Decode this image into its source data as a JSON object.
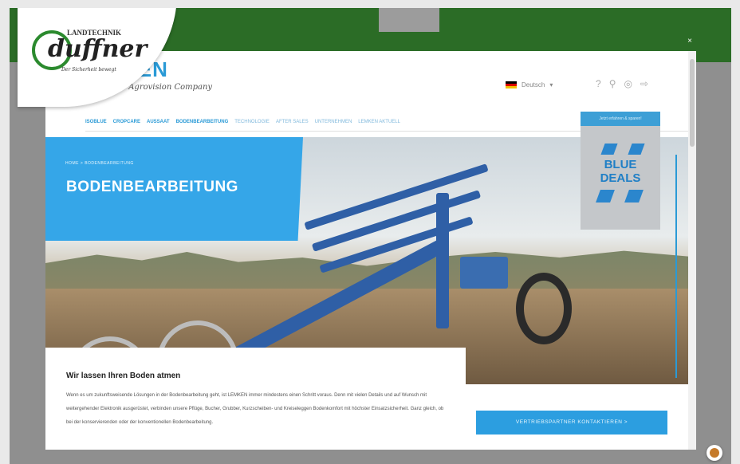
{
  "modal": {
    "close_label": "×"
  },
  "lemken": {
    "logo_text": "EMKEN",
    "tagline": "The Agrovision Company"
  },
  "language": {
    "label": "Deutsch"
  },
  "nav": {
    "items": [
      "ISOBLUE",
      "CROPCARE",
      "AUSSAAT",
      "BODENBEARBEITUNG",
      "TECHNOLOGIE",
      "AFTER SALES",
      "UNTERNEHMEN",
      "LEMKEN AKTUELL"
    ]
  },
  "hero": {
    "breadcrumb": "HOME > BODENBEARBEITUNG",
    "title": "BODENBEARBEITUNG"
  },
  "promo": {
    "top_text": "Jetzt erfahren & sparen!",
    "title": "BLUE DEALS"
  },
  "content": {
    "heading": "Wir lassen Ihren Boden atmen",
    "body": "Wenn es um zukunftsweisende Lösungen in der Bodenbearbeitung geht, ist LEMKEN immer mindestens einen Schritt voraus. Denn mit vielen Details und auf Wunsch mit weitergehender Elektronik ausgerüstet, verbinden unsere Pflüge, Bucher, Grubber, Kurzscheiben- und Kreiseleggen Bodenkomfort mit höchster Einsatzsicherheit. Ganz gleich, ob bei der konservierenden oder der konventionellen Bodenbearbeitung."
  },
  "cta": {
    "label": "VERTRIEBSPARTNER KONTAKTIEREN >"
  },
  "dealer": {
    "top_text": "LANDTECHNIK",
    "name": "duffner",
    "slogan": "Der Sicherheit bewegt"
  },
  "colors": {
    "brand_blue": "#2a9ad6",
    "dealer_green": "#2b6c26"
  },
  "icons": [
    "close-icon",
    "search-icon",
    "user-icon",
    "cart-icon",
    "cookie-icon"
  ]
}
